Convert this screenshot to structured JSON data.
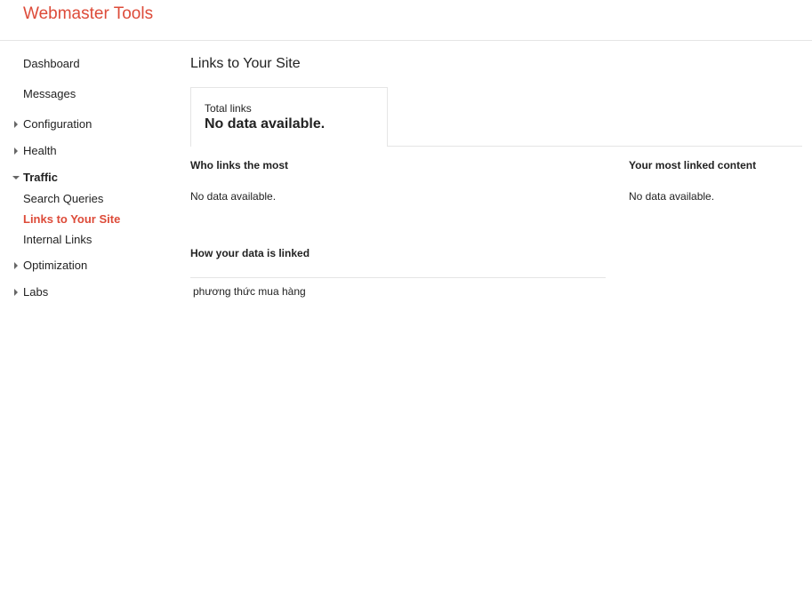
{
  "app": {
    "title": "Webmaster Tools"
  },
  "sidebar": {
    "items": [
      {
        "label": "Dashboard"
      },
      {
        "label": "Messages"
      },
      {
        "label": "Configuration"
      },
      {
        "label": "Health"
      },
      {
        "label": "Traffic"
      },
      {
        "label": "Search Queries"
      },
      {
        "label": "Links to Your Site"
      },
      {
        "label": "Internal Links"
      },
      {
        "label": "Optimization"
      },
      {
        "label": "Labs"
      }
    ]
  },
  "main": {
    "title": "Links to Your Site",
    "total_links": {
      "label": "Total links",
      "value": "No data available."
    },
    "who_links": {
      "heading": "Who links the most",
      "text": "No data available."
    },
    "most_linked": {
      "heading": "Your most linked content",
      "text": "No data available."
    },
    "how_linked": {
      "heading": "How your data is linked",
      "items": [
        "phương thức mua hàng"
      ]
    }
  },
  "colors": {
    "brand": "#dd4b39",
    "text": "#222222",
    "divider": "#e5e5e5"
  }
}
